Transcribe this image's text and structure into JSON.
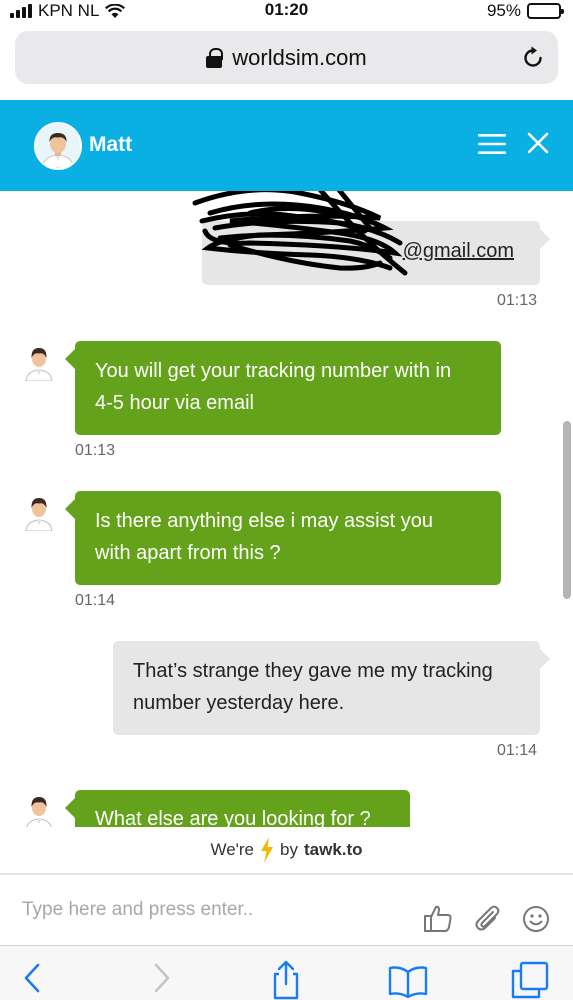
{
  "status_bar": {
    "carrier": "KPN NL",
    "time": "01:20",
    "battery": "95%",
    "battery_level": 0.95
  },
  "browser": {
    "url": "worldsim.com"
  },
  "chat_header": {
    "agent_name": "Matt"
  },
  "messages": [
    {
      "sender": "visitor",
      "text": "@gmail.com",
      "time": "01:13"
    },
    {
      "sender": "agent",
      "lines": [
        "You will get your tracking number with in",
        "4-5 hour via email"
      ],
      "time": "01:13"
    },
    {
      "sender": "agent",
      "lines": [
        "Is there anything else i may assist you",
        "with apart from this ?"
      ],
      "time": "01:14"
    },
    {
      "sender": "visitor",
      "lines": [
        "That’s strange they gave me my tracking",
        "number yesterday here."
      ],
      "time": "01:14"
    },
    {
      "sender": "agent",
      "text": "What else are you looking for ?"
    }
  ],
  "branding": {
    "prefix": "We're",
    "by": "by",
    "brand": "tawk.to"
  },
  "input": {
    "placeholder": "Type here and press enter.."
  },
  "colors": {
    "header": "#0ab0e4",
    "agent_bubble": "#64a21c",
    "visitor_bubble": "#e6e6e6",
    "ios_blue": "#1a7cf3",
    "bolt": "#f5b800"
  }
}
